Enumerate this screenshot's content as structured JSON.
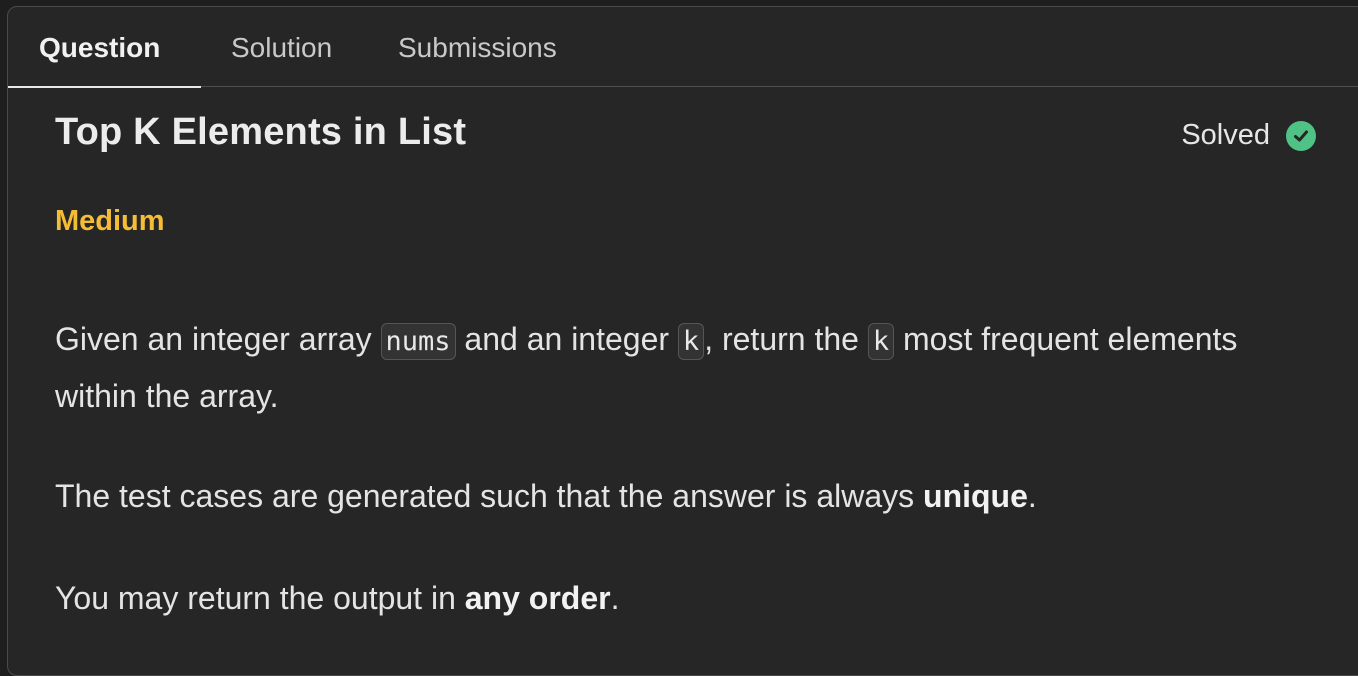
{
  "tabs": [
    {
      "label": "Question",
      "active": true
    },
    {
      "label": "Solution",
      "active": false
    },
    {
      "label": "Submissions",
      "active": false
    }
  ],
  "problem": {
    "title": "Top K Elements in List",
    "status_label": "Solved",
    "status_icon": "check-circle-icon",
    "difficulty": "Medium",
    "difficulty_color": "#f5bd36"
  },
  "description": {
    "p1": {
      "t1": "Given an integer array ",
      "c1": "nums",
      "t2": " and an integer ",
      "c2": "k",
      "t3": ", return the ",
      "c3": "k",
      "t4": " most frequent elements within the array."
    },
    "p2": {
      "t1": "The test cases are generated such that the answer is always ",
      "b1": "unique",
      "t2": "."
    },
    "p3": {
      "t1": "You may return the output in ",
      "b1": "any order",
      "t2": "."
    }
  },
  "colors": {
    "solved_check": "#4fc286",
    "background": "#262626"
  }
}
